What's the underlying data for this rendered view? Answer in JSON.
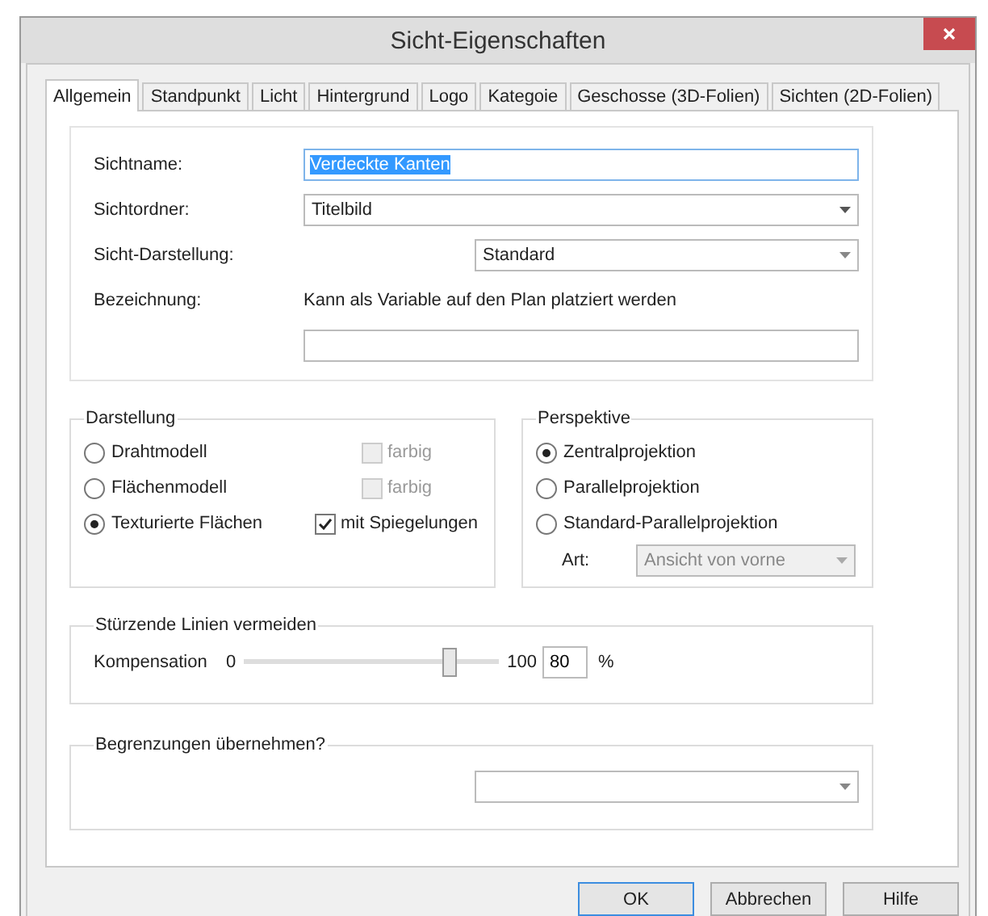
{
  "window": {
    "title": "Sicht-Eigenschaften"
  },
  "tabs": [
    {
      "label": "Allgemein",
      "selected": true
    },
    {
      "label": "Standpunkt",
      "selected": false
    },
    {
      "label": "Licht",
      "selected": false
    },
    {
      "label": "Hintergrund",
      "selected": false
    },
    {
      "label": "Logo",
      "selected": false
    },
    {
      "label": "Kategoie",
      "selected": false
    },
    {
      "label": "Geschosse (3D-Folien)",
      "selected": false
    },
    {
      "label": "Sichten (2D-Folien)",
      "selected": false
    }
  ],
  "general": {
    "name": {
      "label": "Sichtname:",
      "value": "Verdeckte Kanten",
      "highlighted": true
    },
    "folder": {
      "label": "Sichtordner:",
      "value": "Titelbild"
    },
    "display": {
      "label": "Sicht-Darstellung:",
      "value": "Standard"
    },
    "designation": {
      "label": "Bezeichnung:",
      "hint": "Kann als Variable auf den Plan platziert werden"
    }
  },
  "darstellung": {
    "title": "Darstellung",
    "rows": [
      {
        "label": "Drahtmodell",
        "selected": false,
        "option": "farbig",
        "checked": false,
        "disabled": true
      },
      {
        "label": "Flächenmodell",
        "selected": false,
        "option": "farbig",
        "checked": false,
        "disabled": true
      },
      {
        "label": "Texturierte Flächen",
        "selected": true,
        "option": "mit Spiegelungen",
        "checked": true,
        "disabled": false
      }
    ]
  },
  "perspektive": {
    "title": "Perspektive",
    "options": [
      {
        "label": "Zentralprojektion",
        "selected": true
      },
      {
        "label": "Parallelprojektion",
        "selected": false
      },
      {
        "label": "Standard-Parallelprojektion",
        "selected": false
      }
    ],
    "art": {
      "label": "Art:",
      "value": "Ansicht von vorne",
      "disabled": true
    }
  },
  "stuerzende": {
    "title": "Stürzende Linien vermeiden",
    "label": "Kompensation",
    "min": "0",
    "max": "100",
    "level": 0.8,
    "value": "80",
    "unit": "%"
  },
  "begrenzungen": {
    "title": "Begrenzungen übernehmen?"
  },
  "buttons": [
    {
      "label": "OK",
      "default": true
    },
    {
      "label": "Abbrechen",
      "default": false
    },
    {
      "label": "Hilfe",
      "default": false
    }
  ]
}
